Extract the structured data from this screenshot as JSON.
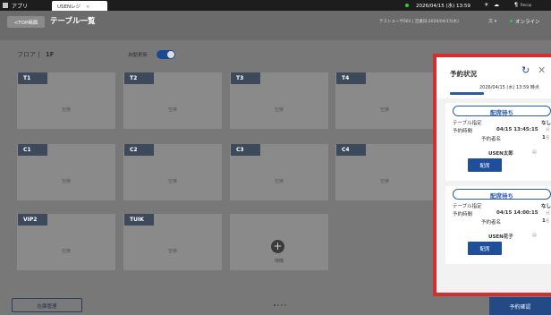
{
  "system": {
    "apps_label": "アプリ",
    "tab_title": "USENレジ",
    "tab_close": "×",
    "datetime": "2026/04/15 (水) 13:59",
    "shop_label": "Recop"
  },
  "header": {
    "top_button": "<TOP画面",
    "title": "テーブル一覧",
    "user_info": "テストユーザ001 | 営業日:2026/04/15(水)",
    "lang": "文 ▾",
    "online": "オンライン"
  },
  "floor": {
    "label": "フロア",
    "value": "1F",
    "auto_refresh_label": "自動更新",
    "auto_refresh_on": true
  },
  "tables": [
    {
      "name": "T1",
      "status": "空席"
    },
    {
      "name": "T2",
      "status": "空席"
    },
    {
      "name": "T3",
      "status": "空席"
    },
    {
      "name": "T4",
      "status": "空席"
    },
    {
      "name": "C1",
      "status": "空席"
    },
    {
      "name": "C2",
      "status": "空席"
    },
    {
      "name": "C3",
      "status": "空席"
    },
    {
      "name": "C4",
      "status": "空席"
    },
    {
      "name": "VIP2",
      "status": "空席"
    },
    {
      "name": "TUIK",
      "status": "空席"
    }
  ],
  "add_table_label": "待機",
  "footer": {
    "inventory_button": "在庫管理",
    "confirm_button": "予約確認"
  },
  "reservation_panel": {
    "title": "予約状況",
    "timestamp": "2026/04/15 (水) 13:59 時点",
    "labels": {
      "table": "テーブル指定",
      "time": "予約時間",
      "count": "予約者名",
      "action": "配席"
    },
    "reservations": [
      {
        "status": "配席待ち",
        "table": "なし",
        "time": "04/15 13:45:15",
        "time_unit": "分",
        "count": "1",
        "count_unit": "名",
        "name": "USEN太郎"
      },
      {
        "status": "配席待ち",
        "table": "なし",
        "time": "04/15 14:00:15",
        "time_unit": "分",
        "count": "1",
        "count_unit": "名",
        "name": "USEN花子"
      }
    ]
  },
  "colors": {
    "overlay": "#787878",
    "highlight_border": "#d62e2e",
    "primary": "#1f4f9a"
  }
}
